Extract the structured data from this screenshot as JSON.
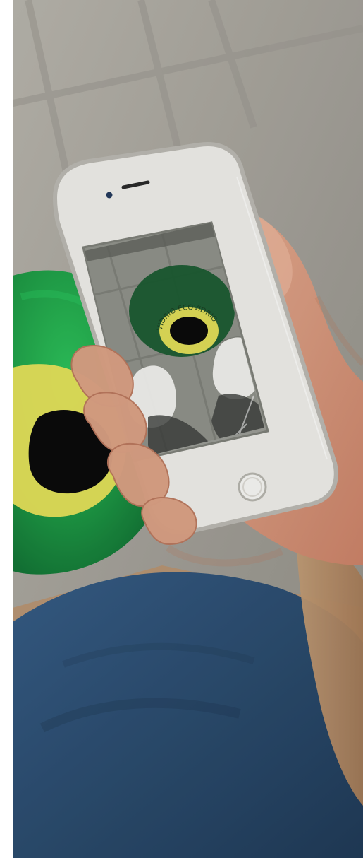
{
  "photo": {
    "colors": {
      "floor": "#a9a7a0",
      "floor_shadow": "#8f8c84",
      "tile_line": "#9a978f",
      "bin_green": "#1f9a45",
      "bin_green_dark": "#137436",
      "bin_ring_yellow": "#e8e05a",
      "bin_hole": "#0b0b0b",
      "phone_frame": "#ecebe6",
      "phone_edge": "#b9b7b0",
      "screen_gray": "#8e9089",
      "screen_dark": "#5d605a",
      "skin": "#d9a084",
      "skin_shadow": "#b9775d",
      "jeans": "#2d4f72",
      "jeans_dark": "#203a56",
      "tan_pants": "#b9916c",
      "tan_dark": "#a57b57"
    },
    "icons": {
      "camera": "front-camera-icon",
      "home": "home-button-icon"
    },
    "screen_logo": {
      "text": "VIDRIO ECOVIDRIO"
    }
  }
}
